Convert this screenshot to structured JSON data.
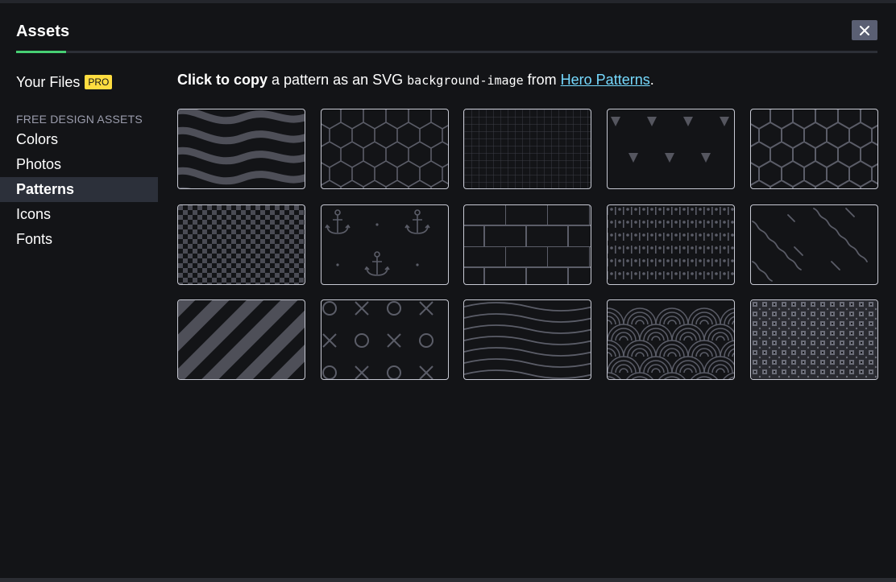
{
  "modal": {
    "title": "Assets",
    "close_icon": "close-icon",
    "accent_color": "#47cf73"
  },
  "sidebar": {
    "your_files": "Your Files",
    "pro_badge": "PRO",
    "section_heading": "FREE DESIGN ASSETS",
    "items": [
      {
        "label": "Colors",
        "active": false
      },
      {
        "label": "Photos",
        "active": false
      },
      {
        "label": "Patterns",
        "active": true
      },
      {
        "label": "Icons",
        "active": false
      },
      {
        "label": "Fonts",
        "active": false
      }
    ]
  },
  "intro": {
    "bold": "Click to copy",
    "text1": " a pattern as an SVG ",
    "code": "background-image",
    "text2": " from ",
    "link": "Hero Patterns",
    "end": "."
  },
  "patterns": [
    {
      "name": "wiggle-waves"
    },
    {
      "name": "hexagons"
    },
    {
      "name": "graph-paper"
    },
    {
      "name": "triangles"
    },
    {
      "name": "hexagons-large"
    },
    {
      "name": "checkerboard"
    },
    {
      "name": "anchors"
    },
    {
      "name": "bricks"
    },
    {
      "name": "dots-and-dashes"
    },
    {
      "name": "squiggles"
    },
    {
      "name": "diagonal-stripes"
    },
    {
      "name": "tic-tac-toe"
    },
    {
      "name": "wavy-lines"
    },
    {
      "name": "japanese-waves"
    },
    {
      "name": "polka-squares"
    }
  ]
}
